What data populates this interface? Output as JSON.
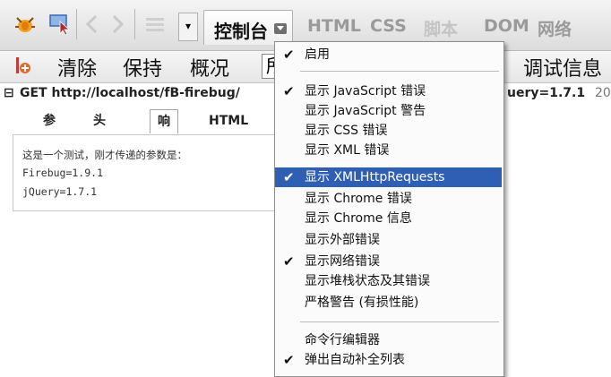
{
  "toolbar": {
    "console_tab": "控制台",
    "tabs": [
      "HTML",
      "CSS",
      "脚本",
      "DOM",
      "网络"
    ]
  },
  "toolbar2": {
    "clear": "清除",
    "persist": "保持",
    "profile": "概况",
    "filter_value": "所",
    "debug_info": "调试信息"
  },
  "request": {
    "method_url": "GET http://localhost/fB-firebug/",
    "query": "uery=1.7.1",
    "extra": "20"
  },
  "subtabs": [
    "参数",
    "头信息",
    "响应",
    "HTML"
  ],
  "response": {
    "lines": [
      "这是一个测试，刚才传递的参数是：",
      "Firebug=1.9.1",
      "jQuery=1.7.1"
    ]
  },
  "menu": {
    "items": [
      {
        "label": "启用",
        "checked": true,
        "highlighted": false
      },
      {
        "label": "显示 JavaScript 错误",
        "checked": true,
        "highlighted": false
      },
      {
        "label": "显示 JavaScript 警告",
        "checked": false,
        "highlighted": false
      },
      {
        "label": "显示 CSS 错误",
        "checked": false,
        "highlighted": false
      },
      {
        "label": "显示 XML 错误",
        "checked": false,
        "highlighted": false
      },
      {
        "label": "显示 XMLHttpRequests",
        "checked": true,
        "highlighted": true
      },
      {
        "label": "显示 Chrome 错误",
        "checked": false,
        "highlighted": false
      },
      {
        "label": "显示 Chrome 信息",
        "checked": false,
        "highlighted": false
      },
      {
        "label": "显示外部错误",
        "checked": false,
        "highlighted": false
      },
      {
        "label": "显示网络错误",
        "checked": true,
        "highlighted": false
      },
      {
        "label": "显示堆栈状态及其错误",
        "checked": false,
        "highlighted": false
      },
      {
        "label": "严格警告 (有损性能)",
        "checked": false,
        "highlighted": false
      },
      {
        "label": "命令行编辑器",
        "checked": false,
        "highlighted": false
      },
      {
        "label": "弹出自动补全列表",
        "checked": true,
        "highlighted": false
      }
    ],
    "check_glyph": "✔"
  },
  "colors": {
    "highlight": "#2f5fb4",
    "toolbar_bg": "#dcdcdc"
  }
}
